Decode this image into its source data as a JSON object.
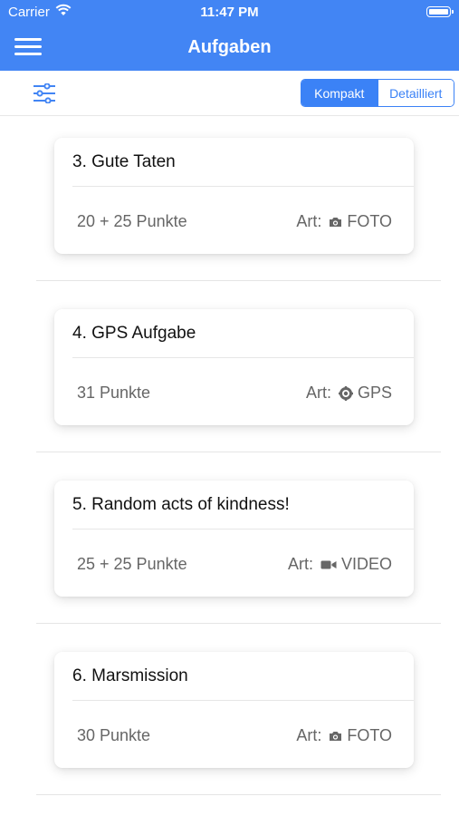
{
  "status_bar": {
    "carrier": "Carrier",
    "time": "11:47 PM"
  },
  "header": {
    "title": "Aufgaben",
    "menu_icon": "hamburger-menu-icon"
  },
  "toolbar": {
    "filter_icon": "sliders-icon",
    "view_toggle": {
      "options": [
        "Kompakt",
        "Detailliert"
      ],
      "selected": "Kompakt"
    }
  },
  "tasks": [
    {
      "title": "3. Gute Taten",
      "points": "20 + 25 Punkte",
      "type_label": "Art:",
      "type": "FOTO",
      "type_icon": "camera-icon"
    },
    {
      "title": "4. GPS Aufgabe",
      "points": "31 Punkte",
      "type_label": "Art:",
      "type": "GPS",
      "type_icon": "gps-icon"
    },
    {
      "title": "5. Random acts of kindness!",
      "points": "25 + 25 Punkte",
      "type_label": "Art:",
      "type": "VIDEO",
      "type_icon": "video-camera-icon"
    },
    {
      "title": "6. Marsmission",
      "points": "30 Punkte",
      "type_label": "Art:",
      "type": "FOTO",
      "type_icon": "camera-icon"
    }
  ],
  "colors": {
    "primary": "#4285f4",
    "segment": "#3b82f6",
    "muted_text": "#666666"
  }
}
